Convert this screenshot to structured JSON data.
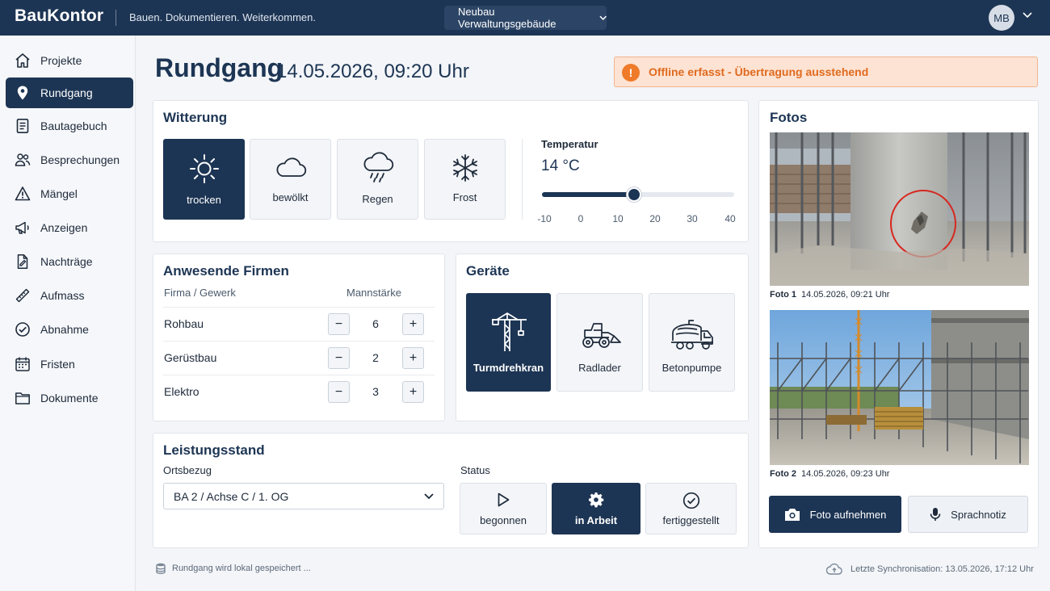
{
  "app": {
    "logo": "BauKontor",
    "tagline": "Bauen. Dokumentieren. Weiterkommen.",
    "project": "Neubau Verwaltungsgebäude",
    "user_initials": "MB"
  },
  "sidebar": {
    "items": [
      {
        "label": "Projekte",
        "icon": "home-icon",
        "active": false
      },
      {
        "label": "Rundgang",
        "icon": "map-pin-icon",
        "active": true
      },
      {
        "label": "Bautagebuch",
        "icon": "document-icon",
        "active": false
      },
      {
        "label": "Besprechungen",
        "icon": "people-icon",
        "active": false
      },
      {
        "label": "Mängel",
        "icon": "warning-icon",
        "active": false
      },
      {
        "label": "Anzeigen",
        "icon": "megaphone-icon",
        "active": false
      },
      {
        "label": "Nachträge",
        "icon": "edit-document-icon",
        "active": false
      },
      {
        "label": "Aufmass",
        "icon": "ruler-icon",
        "active": false
      },
      {
        "label": "Abnahme",
        "icon": "check-circle-icon",
        "active": false
      },
      {
        "label": "Fristen",
        "icon": "calendar-icon",
        "active": false
      },
      {
        "label": "Dokumente",
        "icon": "folder-icon",
        "active": false
      }
    ]
  },
  "header": {
    "title": "Rundgang",
    "date": "14.05.2026, 09:20 Uhr",
    "offline_notice": "Offline erfasst - Übertragung ausstehend"
  },
  "weather": {
    "title": "Witterung",
    "options": [
      {
        "label": "trocken",
        "icon": "sun-icon",
        "selected": true
      },
      {
        "label": "bewölkt",
        "icon": "cloud-icon",
        "selected": false
      },
      {
        "label": "Regen",
        "icon": "rain-icon",
        "selected": false
      },
      {
        "label": "Frost",
        "icon": "snowflake-icon",
        "selected": false
      }
    ],
    "temperature_label": "Temperatur",
    "temperature_value": "14 °C",
    "temperature": 14,
    "temperature_min": -10,
    "temperature_max": 40,
    "ticks": [
      "-10",
      "0",
      "10",
      "20",
      "30",
      "40"
    ]
  },
  "firms": {
    "title": "Anwesende Firmen",
    "col_firm": "Firma / Gewerk",
    "col_staff": "Mannstärke",
    "rows": [
      {
        "name": "Rohbau",
        "count": "6"
      },
      {
        "name": "Gerüstbau",
        "count": "2"
      },
      {
        "name": "Elektro",
        "count": "3"
      }
    ],
    "minus": "−",
    "plus": "+"
  },
  "equipment": {
    "title": "Geräte",
    "items": [
      {
        "label": "Turmdrehkran",
        "icon": "tower-crane-icon",
        "selected": true
      },
      {
        "label": "Radlader",
        "icon": "wheel-loader-icon",
        "selected": false
      },
      {
        "label": "Betonpumpe",
        "icon": "concrete-mixer-icon",
        "selected": false
      }
    ]
  },
  "progress": {
    "title": "Leistungsstand",
    "location_label": "Ortsbezug",
    "location_value": "BA 2 / Achse C / 1. OG",
    "status_label": "Status",
    "statuses": [
      {
        "label": "begonnen",
        "icon": "play-icon",
        "selected": false
      },
      {
        "label": "in Arbeit",
        "icon": "gear-icon",
        "selected": true
      },
      {
        "label": "fertiggestellt",
        "icon": "check-circle-icon",
        "selected": false
      }
    ]
  },
  "photos": {
    "title": "Fotos",
    "items": [
      {
        "label": "Foto 1",
        "timestamp": "14.05.2026, 09:21 Uhr"
      },
      {
        "label": "Foto 2",
        "timestamp": "14.05.2026, 09:23 Uhr"
      }
    ],
    "take_photo": "Foto aufnehmen",
    "voice_note": "Sprachnotiz"
  },
  "footer": {
    "local_save": "Rundgang wird lokal gespeichert ...",
    "last_sync": "Letzte Synchronisation: 13.05.2026, 17:12 Uhr"
  },
  "colors": {
    "primary": "#1d3554",
    "warning": "#ef7a2a",
    "warning_bg": "#fde3d3"
  }
}
